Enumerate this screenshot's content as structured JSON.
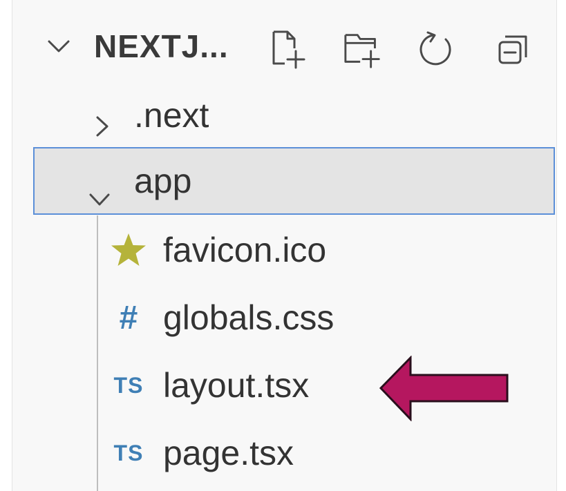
{
  "explorer": {
    "section_title": "NEXTJ...",
    "actions": {
      "new_file": "new-file",
      "new_folder": "new-folder",
      "refresh": "refresh",
      "collapse_all": "collapse-all"
    },
    "items": [
      {
        "label": ".next",
        "type": "folder",
        "expanded": false
      },
      {
        "label": "app",
        "type": "folder",
        "expanded": true,
        "selected": true
      },
      {
        "label": "favicon.ico",
        "type": "file",
        "icon": "star-icon"
      },
      {
        "label": "globals.css",
        "type": "file",
        "icon": "hash-icon",
        "icon_text": "#"
      },
      {
        "label": "layout.tsx",
        "type": "file",
        "icon": "typescript-icon",
        "icon_text": "TS"
      },
      {
        "label": "page.tsx",
        "type": "file",
        "icon": "typescript-icon",
        "icon_text": "TS"
      }
    ]
  },
  "colors": {
    "selection_border": "#5b8fd8",
    "selection_bg": "#e4e4e4",
    "star": "#b5b33a",
    "ts": "#3f7fb5",
    "arrow": "#b5175f"
  }
}
